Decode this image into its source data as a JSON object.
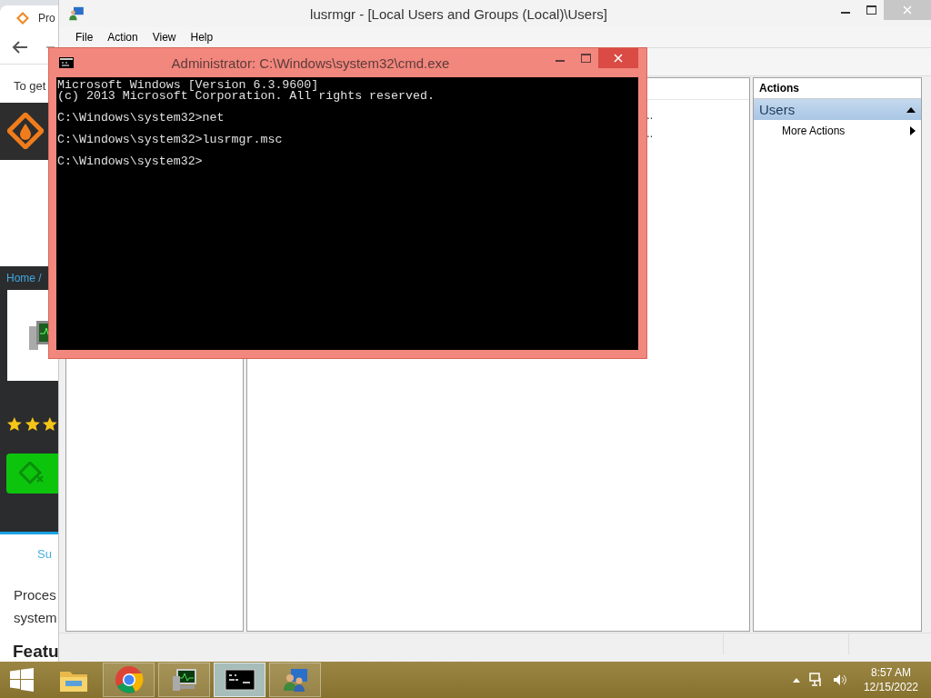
{
  "browser": {
    "tab_title": "Pro",
    "notice": "To get",
    "breadcrumb": "Home /",
    "stars": 3,
    "summary_link": "Su",
    "paragraph_lines": [
      "Proces",
      "system"
    ],
    "heading": "Featu"
  },
  "mmc": {
    "title": "lusrmgr - [Local Users and Groups (Local)\\Users]",
    "menu": [
      "File",
      "Action",
      "View",
      "Help"
    ],
    "rows": [
      "..",
      ".."
    ],
    "actions_header": "Actions",
    "section": {
      "label": "Users",
      "expanded": true
    },
    "action_items": [
      {
        "label": "More Actions"
      }
    ]
  },
  "cmd": {
    "title": "Administrator: C:\\Windows\\system32\\cmd.exe",
    "blocks": [
      [
        "Microsoft Windows [Version 6.3.9600]",
        "(c) 2013 Microsoft Corporation. All rights reserved."
      ],
      [
        "C:\\Windows\\system32>net"
      ],
      [
        "C:\\Windows\\system32>lusrmgr.msc"
      ],
      [
        "C:\\Windows\\system32>"
      ]
    ]
  },
  "taskbar": {
    "apps": [
      {
        "kind": "folder",
        "running": false,
        "active": false
      },
      {
        "kind": "browser",
        "running": true,
        "active": false
      },
      {
        "kind": "monitor",
        "running": true,
        "active": false
      },
      {
        "kind": "console",
        "running": true,
        "active": true
      },
      {
        "kind": "users",
        "running": true,
        "active": false
      }
    ],
    "time": "8:57 AM",
    "date": "12/15/2022"
  }
}
